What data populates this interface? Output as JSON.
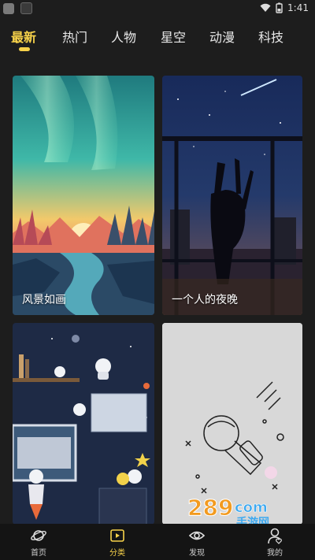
{
  "status_bar": {
    "time": "1:41"
  },
  "tabs": [
    {
      "label": "最新",
      "active": true
    },
    {
      "label": "热门",
      "active": false
    },
    {
      "label": "人物",
      "active": false
    },
    {
      "label": "星空",
      "active": false
    },
    {
      "label": "动漫",
      "active": false
    },
    {
      "label": "科技",
      "active": false
    }
  ],
  "cards": [
    {
      "title": "风景如画"
    },
    {
      "title": "一个人的夜晚"
    },
    {
      "title": ""
    },
    {
      "title": ""
    }
  ],
  "bottom_nav": [
    {
      "label": "首页",
      "icon": "planet-icon",
      "active": false
    },
    {
      "label": "分类",
      "icon": "play-folder-icon",
      "active": true
    },
    {
      "label": "发现",
      "icon": "eye-icon",
      "active": false
    },
    {
      "label": "我的",
      "icon": "user-heart-icon",
      "active": false
    }
  ],
  "watermark": {
    "brand": "289",
    "domain": "com",
    "sub": "手游网"
  },
  "colors": {
    "accent": "#f7d24a",
    "background": "#1d1d1d",
    "nav_bg": "#141414"
  }
}
